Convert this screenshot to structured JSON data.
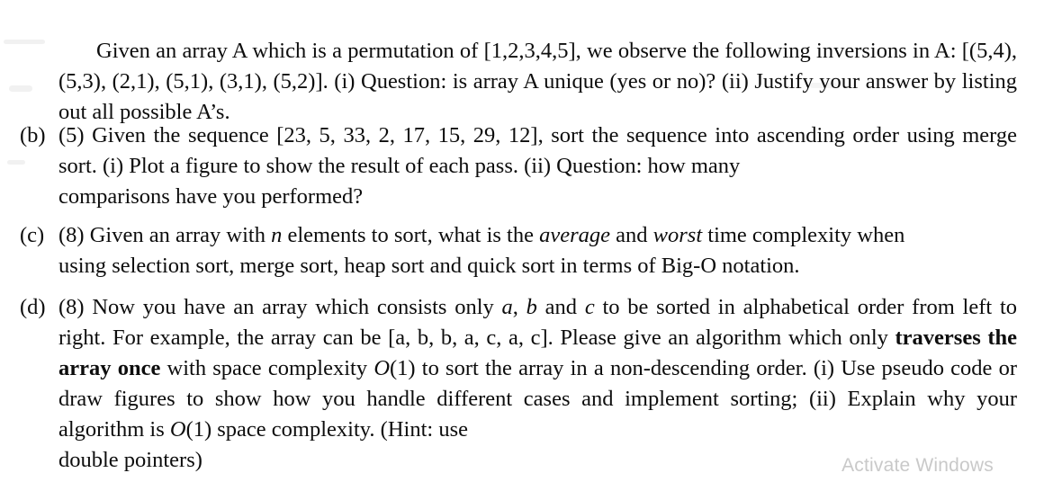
{
  "document": {
    "background_color": "#ffffff",
    "text_color": "#0d0d0d"
  },
  "lead_paragraph": {
    "segment_1": "Given an array A which is a permutation of [1,2,3,4,5], we observe the following inversions in A: [(5,4), (5,3), (2,1), (5,1), (3,1), (5,2)].  (i) Question: is array A unique (yes or no)?  (ii) Justify your answer by listing out all possible A’s.",
    "array_name": "A",
    "permutation": "[1,2,3,4,5]",
    "inversions": "[(5,4), (5,3), (2,1), (5,1), (3,1), (5,2)]",
    "sub_questions": [
      "(i) Question: is array A unique (yes or no)?",
      "(ii) Justify your answer by listing out all possible A’s."
    ]
  },
  "items": [
    {
      "label": "(b)",
      "points": "(5)",
      "text_1": "(5) Given the sequence [23, 5, 33, 2, 17, 15, 29, 12], sort the sequence into ascending order using merge sort.  (i) Plot a figure to show the result of each pass.  (ii) Question: how many",
      "text_last": "comparisons have you performed?",
      "sequence": "[23, 5, 33, 2, 17, 15, 29, 12]",
      "sequence_values": [
        23,
        5,
        33,
        2,
        17,
        15,
        29,
        12
      ],
      "algorithm": "merge sort"
    },
    {
      "label": "(c)",
      "points": "(8)",
      "text_1_a": "(8) Given an array with ",
      "var_n": "n",
      "text_1_b": " elements to sort, what is the ",
      "emph_average": "average",
      "text_1_c": " and ",
      "emph_worst": "worst",
      "text_1_d": " time complexity when",
      "text_last": "using selection sort, merge sort, heap sort and quick sort in terms of Big-O notation.",
      "sorts": [
        "selection sort",
        "merge sort",
        "heap sort",
        "quick sort"
      ]
    },
    {
      "label": "(d)",
      "points": "(8)",
      "text_a": "(8) Now you have an array which consists only ",
      "var_a": "a",
      "text_b": ", ",
      "var_b": "b",
      "text_c": " and ",
      "var_c": "c",
      "text_d": " to be sorted in alphabetical order from left to right.  For example, the array can be [a, b, b, a, c, a, c].  Please give an algorithm which only ",
      "bold_phrase": "traverses the array once",
      "text_e": " with space complexity ",
      "bigo_1": "O(1)",
      "text_f": " to sort the array in a non-descending order.  (i) Use pseudo code or draw figures to show how you handle different cases and implement sorting; (ii) Explain why your algorithm is ",
      "bigo_2": "O(1)",
      "text_g": " space complexity.  (Hint:  use",
      "text_last": "double pointers)",
      "example_array": "[a, b, b, a, c, a, c]",
      "space_complexity": "O(1)"
    }
  ],
  "watermark": {
    "text": "Activate Windows",
    "color": "#c9c9c9"
  }
}
